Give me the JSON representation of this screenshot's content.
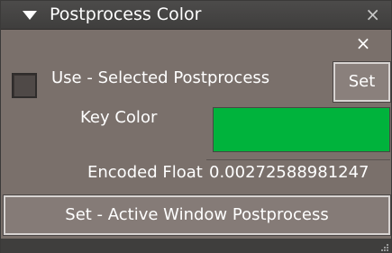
{
  "window": {
    "title": "Postprocess Color",
    "close_glyph": "×",
    "inner_close_glyph": "×"
  },
  "use_selected": {
    "label": "Use - Selected Postprocess",
    "checked": false,
    "set_label": "Set"
  },
  "key_color": {
    "label": "Key Color",
    "value": "#00b33c"
  },
  "encoded_float": {
    "label": "Encoded Float",
    "value": "0.00272588981247"
  },
  "active_window": {
    "button_label": "Set - Active Window Postprocess"
  },
  "icons": {
    "collapse": "triangle-down-icon",
    "close": "close-icon",
    "resize": "resize-grip-icon"
  },
  "colors": {
    "panel_bg": "#7a706b",
    "titlebar_bg": "#4c4b4a",
    "swatch": "#00b33c"
  }
}
